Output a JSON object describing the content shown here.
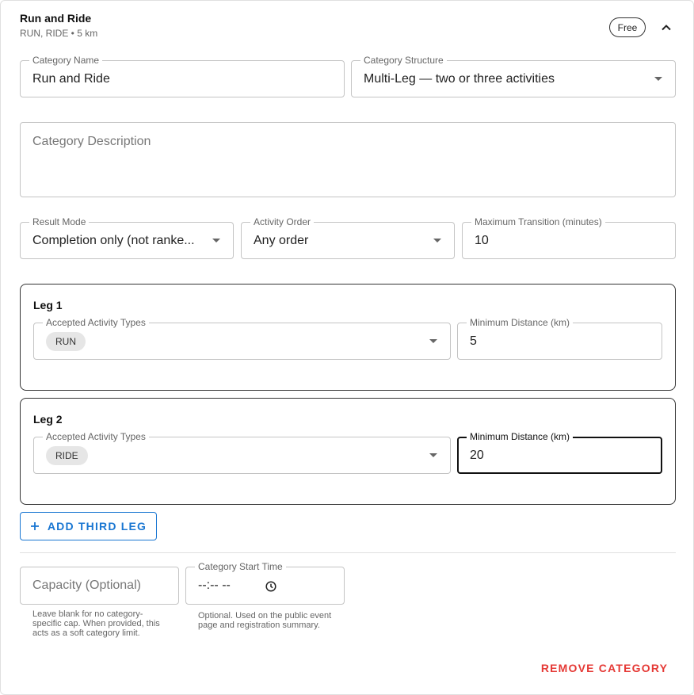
{
  "header": {
    "title": "Run and Ride",
    "subtitle": "RUN, RIDE • 5 km",
    "price_badge": "Free",
    "collapse_icon": "chevron-up-icon"
  },
  "category_name": {
    "label": "Category Name",
    "value": "Run and Ride"
  },
  "category_structure": {
    "label": "Category Structure",
    "value": "Multi-Leg — two or three activities"
  },
  "category_description": {
    "placeholder": "Category Description"
  },
  "result_mode": {
    "label": "Result Mode",
    "value": "Completion only (not ranke..."
  },
  "activity_order": {
    "label": "Activity Order",
    "value": "Any order"
  },
  "max_transition": {
    "label": "Maximum Transition (minutes)",
    "value": "10"
  },
  "legs": [
    {
      "title": "Leg 1",
      "activity_label": "Accepted Activity Types",
      "activity_chip": "RUN",
      "distance_label": "Minimum Distance (km)",
      "distance_value": "5"
    },
    {
      "title": "Leg 2",
      "activity_label": "Accepted Activity Types",
      "activity_chip": "RIDE",
      "distance_label": "Minimum Distance (km)",
      "distance_value": "20"
    }
  ],
  "add_leg_button": {
    "icon": "plus-icon",
    "label": "ADD THIRD LEG"
  },
  "capacity": {
    "placeholder": "Capacity (Optional)",
    "helper": "Leave blank for no category-specific cap. When provided, this acts as a soft category limit."
  },
  "start_time": {
    "label": "Category Start Time",
    "value": "--:-- --",
    "icon": "clock-icon",
    "helper": "Optional. Used on the public event page and registration summary."
  },
  "remove_button": {
    "label": "REMOVE CATEGORY"
  },
  "colors": {
    "primary": "#1976d2",
    "danger": "#e53935",
    "focused_border": "#111111"
  }
}
